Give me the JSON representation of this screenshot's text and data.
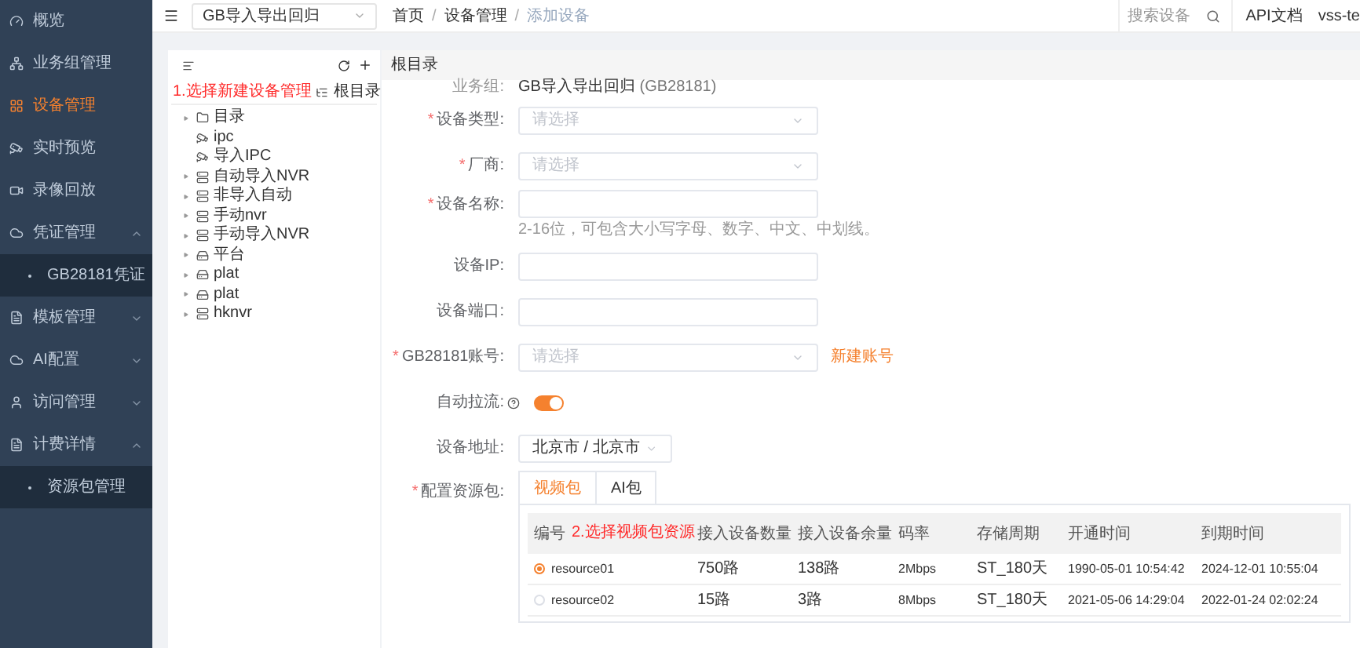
{
  "sidebar": {
    "items": [
      {
        "label": "概览",
        "selected": false
      },
      {
        "label": "业务组管理",
        "selected": false
      },
      {
        "label": "设备管理",
        "selected": true
      },
      {
        "label": "实时预览",
        "selected": false
      },
      {
        "label": "录像回放",
        "selected": false
      },
      {
        "label": "凭证管理",
        "selected": false,
        "expanded": true,
        "children": [
          {
            "label": "GB28181凭证",
            "selected": false
          }
        ]
      },
      {
        "label": "模板管理",
        "selected": false,
        "expanded": false
      },
      {
        "label": "AI配置",
        "selected": false,
        "expanded": false
      },
      {
        "label": "访问管理",
        "selected": false,
        "expanded": false
      },
      {
        "label": "计费详情",
        "selected": false,
        "expanded": true,
        "children": [
          {
            "label": "资源包管理",
            "selected": false
          }
        ]
      }
    ]
  },
  "annotation_1": "1.选择新建设备管理",
  "header": {
    "group_select": "GB导入导出回归",
    "breadcrumb": [
      "首页",
      "设备管理",
      "添加设备"
    ],
    "breadcrumb_separator": "/",
    "search": {
      "placeholder": "搜索设备"
    },
    "links": [
      "API文档",
      "vss-te"
    ]
  },
  "tree": {
    "root": "根目录",
    "children": [
      {
        "label": "目录",
        "kind": "folder",
        "expandable": true
      },
      {
        "label": "ipc",
        "kind": "camera",
        "expandable": false
      },
      {
        "label": "导入IPC",
        "kind": "camera",
        "expandable": false
      },
      {
        "label": "自动导入NVR",
        "kind": "nvr",
        "expandable": true
      },
      {
        "label": "非导入自动",
        "kind": "nvr",
        "expandable": true
      },
      {
        "label": "手动nvr",
        "kind": "nvr",
        "expandable": true
      },
      {
        "label": "手动导入NVR",
        "kind": "nvr",
        "expandable": true
      },
      {
        "label": "平台",
        "kind": "platform",
        "expandable": true
      },
      {
        "label": "plat",
        "kind": "platform",
        "expandable": true
      },
      {
        "label": "plat",
        "kind": "platform",
        "expandable": true
      },
      {
        "label": "hknvr",
        "kind": "nvr",
        "expandable": true
      }
    ]
  },
  "form": {
    "title": "根目录",
    "required_mark": "*",
    "group": {
      "label": "业务组:",
      "value": "GB导入导出回归",
      "suffix": "(GB28181)"
    },
    "fields": [
      {
        "kind": "select",
        "label": "设备类型:",
        "required": true,
        "placeholder": "请选择"
      },
      {
        "kind": "select",
        "label": "厂商:",
        "required": true,
        "placeholder": "请选择"
      },
      {
        "kind": "input",
        "label": "设备名称:",
        "required": true,
        "hint": "2-16位，可包含大小写字母、数字、中文、中划线。"
      },
      {
        "kind": "input",
        "label": "设备IP:",
        "required": false
      },
      {
        "kind": "input",
        "label": "设备端口:",
        "required": false
      },
      {
        "kind": "select",
        "label": "GB28181账号:",
        "required": true,
        "placeholder": "请选择",
        "link": "新建账号"
      },
      {
        "kind": "switch",
        "label": "自动拉流:",
        "required": false,
        "on": true
      },
      {
        "kind": "cascader",
        "label": "设备地址:",
        "required": false,
        "value": "北京市 / 北京市"
      }
    ],
    "package": {
      "label": "配置资源包:",
      "required": true,
      "tabs": [
        {
          "label": "视频包",
          "selected": true
        },
        {
          "label": "AI包",
          "selected": false
        }
      ],
      "annotation_2": "2.选择视频包资源",
      "columns": [
        "编号",
        "接入设备数量",
        "接入设备余量",
        "码率",
        "存储周期",
        "开通时间",
        "到期时间"
      ],
      "rows": [
        {
          "selected": true,
          "cells": [
            "resource01",
            "750路",
            "138路",
            "2Mbps",
            "ST_180天",
            "1990-05-01 10:54:42",
            "2024-12-01 10:55:04"
          ]
        },
        {
          "selected": false,
          "cells": [
            "resource02",
            "15路",
            "3路",
            "8Mbps",
            "ST_180天",
            "2021-05-06 14:29:04",
            "2022-01-24 02:02:24"
          ]
        }
      ]
    }
  }
}
